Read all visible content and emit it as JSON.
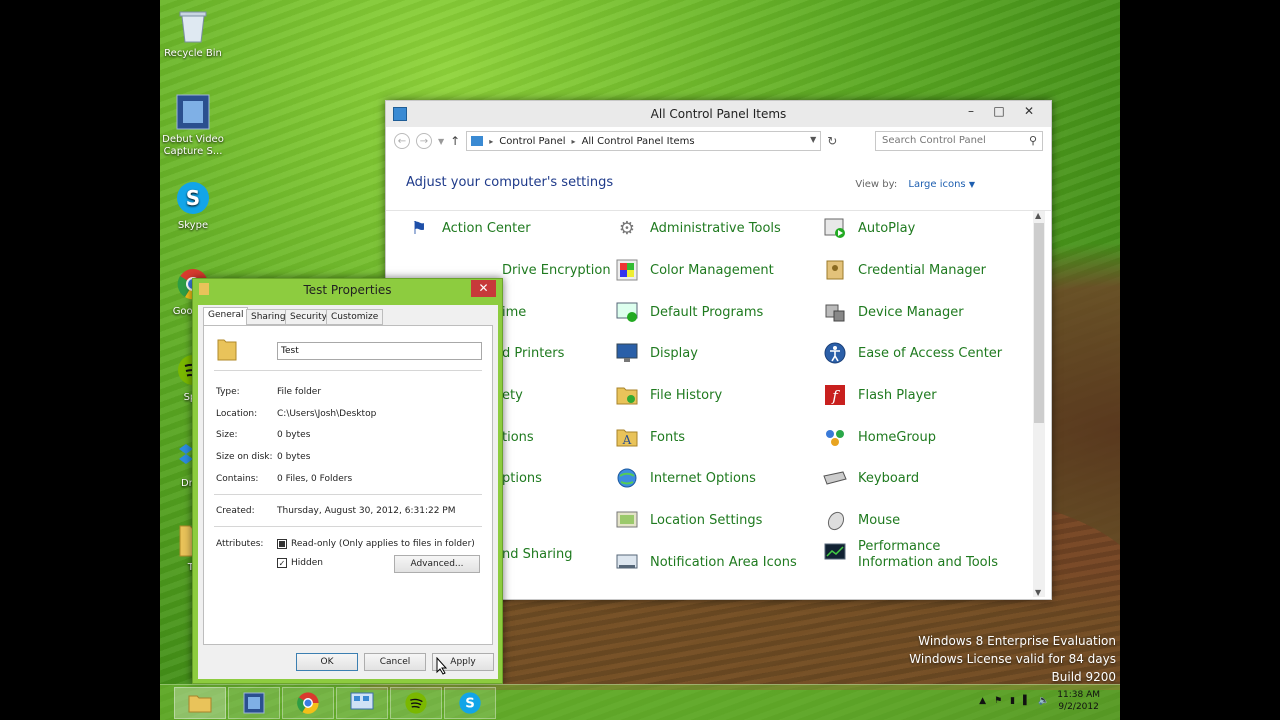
{
  "desktop": {
    "icons": [
      {
        "label": "Recycle Bin",
        "icon": "recycle-bin-icon"
      },
      {
        "label": "Debut Video Capture S...",
        "icon": "debut-video-icon"
      },
      {
        "label": "Skype",
        "icon": "skype-icon"
      },
      {
        "label": "Goo Chr",
        "icon": "chrome-icon"
      },
      {
        "label": "Spo",
        "icon": "spotify-icon"
      },
      {
        "label": "Drop",
        "icon": "dropbox-icon"
      },
      {
        "label": "Te",
        "icon": "folder-icon"
      }
    ],
    "watermark": {
      "line1": "Windows 8 Enterprise Evaluation",
      "line2": "Windows License valid for 84 days",
      "line3": "Build 9200"
    }
  },
  "control_panel": {
    "title": "All Control Panel Items",
    "address": [
      "Control Panel",
      "All Control Panel Items"
    ],
    "search_placeholder": "Search Control Panel",
    "heading": "Adjust your computer's settings",
    "view_by_label": "View by:",
    "view_by_value": "Large icons",
    "items": [
      {
        "label": "Action Center",
        "icon": "flag-icon"
      },
      {
        "label": "Administrative Tools",
        "icon": "tools-icon"
      },
      {
        "label": "AutoPlay",
        "icon": "autoplay-icon"
      },
      {
        "label": "Drive Encryption",
        "icon": "bitlocker-icon"
      },
      {
        "label": "Color Management",
        "icon": "color-icon"
      },
      {
        "label": "Credential Manager",
        "icon": "credential-icon"
      },
      {
        "label": "ime",
        "icon": "clock-icon"
      },
      {
        "label": "Default Programs",
        "icon": "default-programs-icon"
      },
      {
        "label": "Device Manager",
        "icon": "device-manager-icon"
      },
      {
        "label": "d Printers",
        "icon": "printer-icon"
      },
      {
        "label": "Display",
        "icon": "display-icon"
      },
      {
        "label": "Ease of Access Center",
        "icon": "ease-of-access-icon"
      },
      {
        "label": "ety",
        "icon": "family-icon"
      },
      {
        "label": "File History",
        "icon": "file-history-icon"
      },
      {
        "label": "Flash Player",
        "icon": "flash-icon"
      },
      {
        "label": "tions",
        "icon": "folder-options-icon"
      },
      {
        "label": "Fonts",
        "icon": "fonts-icon"
      },
      {
        "label": "HomeGroup",
        "icon": "homegroup-icon"
      },
      {
        "label": "ptions",
        "icon": "indexing-icon"
      },
      {
        "label": "Internet Options",
        "icon": "internet-icon"
      },
      {
        "label": "Keyboard",
        "icon": "keyboard-icon"
      },
      {
        "label": "",
        "icon": "language-icon"
      },
      {
        "label": "Location Settings",
        "icon": "location-icon"
      },
      {
        "label": "Mouse",
        "icon": "mouse-icon"
      },
      {
        "label": "nd Sharing",
        "icon": "network-icon"
      },
      {
        "label": "Notification Area Icons",
        "icon": "notification-icon"
      },
      {
        "label": "Performance Information and Tools",
        "icon": "performance-icon"
      }
    ]
  },
  "properties": {
    "title": "Test Properties",
    "tabs": [
      "General",
      "Sharing",
      "Security",
      "Customize"
    ],
    "name_value": "Test",
    "type_label": "Type:",
    "type_value": "File folder",
    "location_label": "Location:",
    "location_value": "C:\\Users\\Josh\\Desktop",
    "size_label": "Size:",
    "size_value": "0 bytes",
    "size_on_disk_label": "Size on disk:",
    "size_on_disk_value": "0 bytes",
    "contains_label": "Contains:",
    "contains_value": "0 Files, 0 Folders",
    "created_label": "Created:",
    "created_value": "Thursday, August 30, 2012, 6:31:22 PM",
    "attributes_label": "Attributes:",
    "readonly_label": "Read-only (Only applies to files in folder)",
    "hidden_label": "Hidden",
    "advanced_label": "Advanced...",
    "ok_label": "OK",
    "cancel_label": "Cancel",
    "apply_label": "Apply"
  },
  "taskbar": {
    "time": "11:38 AM",
    "date": "9/2/2012"
  }
}
